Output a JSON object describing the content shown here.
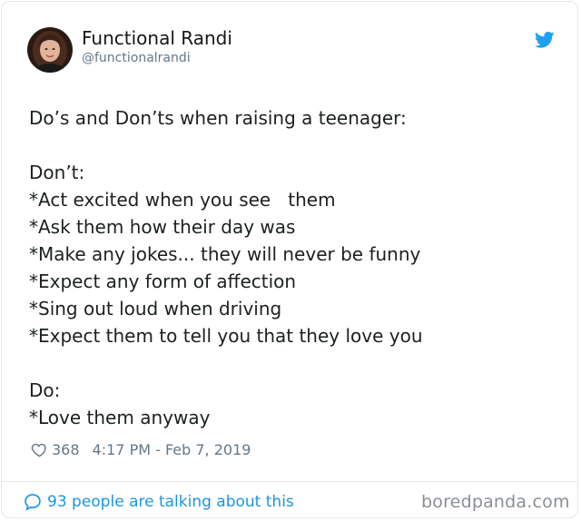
{
  "author": {
    "name": "Functional Randi",
    "handle": "@functionalrandi"
  },
  "tweet": {
    "intro": "Do’s and Don’ts when raising a teenager:",
    "dont_label": "Don’t:",
    "dont_items": [
      "*Act excited when you see   them",
      "*Ask them how their day was",
      "*Make any jokes... they will never be funny",
      "*Expect any form of affection",
      "*Sing out loud when driving",
      "*Expect them to tell you that they love you"
    ],
    "do_label": "Do:",
    "do_items": [
      "*Love them anyway"
    ]
  },
  "meta": {
    "likes": "368",
    "timestamp": "4:17 PM - Feb 7, 2019"
  },
  "footer": {
    "talking": "93 people are talking about this",
    "brand": "boredpanda.com"
  },
  "icons": {
    "twitter_bird": "twitter-bird-icon",
    "heart": "heart-icon",
    "comment": "speech-bubble-icon"
  },
  "colors": {
    "twitter_blue": "#1da1f2",
    "link_blue": "#1b95e0",
    "muted_gray": "#657786"
  }
}
